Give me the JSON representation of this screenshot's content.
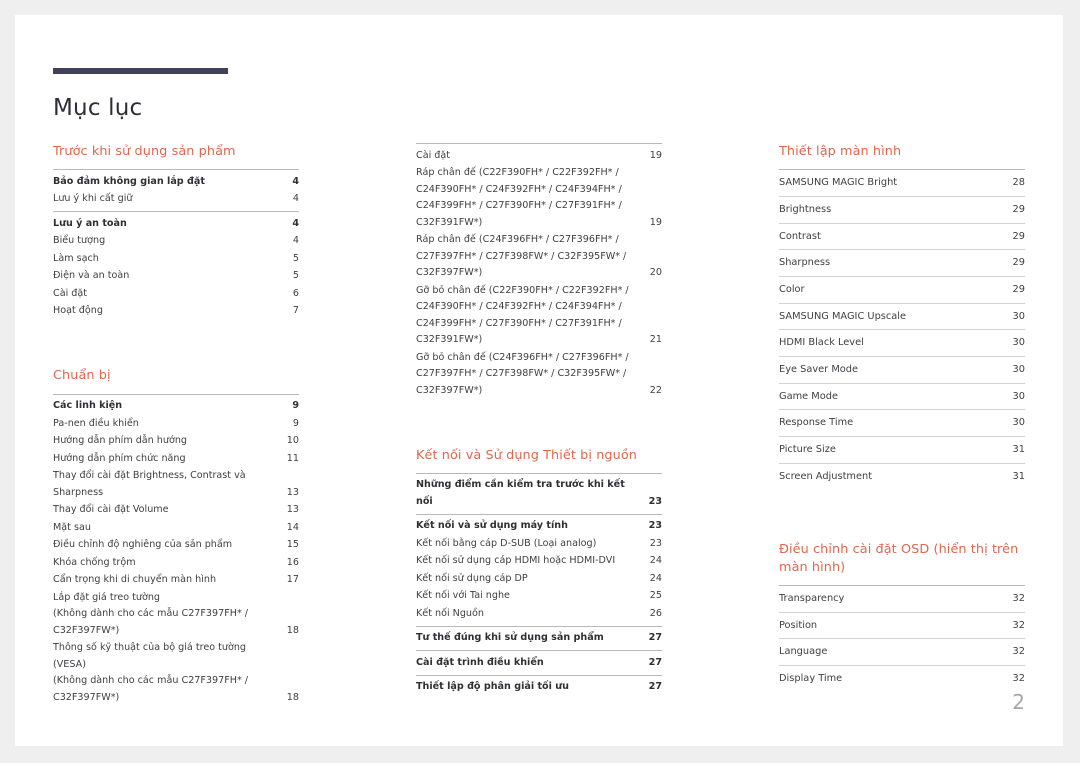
{
  "document": {
    "title": "Mục lục",
    "page_number": "2",
    "accent_color": "#e0674a",
    "rule_color": "#41415a"
  },
  "columns": [
    {
      "id": "column-left",
      "sections": [
        {
          "heading": "Trước khi sử dụng sản phẩm",
          "groups": [
            {
              "rows": [
                {
                  "label": "Bảo đảm không gian lắp đặt",
                  "page": "4",
                  "bold": true
                },
                {
                  "label": "Lưu ý khi cất giữ",
                  "page": "4",
                  "bold": false
                }
              ]
            },
            {
              "rows": [
                {
                  "label": "Lưu ý an toàn",
                  "page": "4",
                  "bold": true
                },
                {
                  "label": "Biểu tượng",
                  "page": "4",
                  "bold": false
                },
                {
                  "label": "Làm sạch",
                  "page": "5",
                  "bold": false
                },
                {
                  "label": "Điện và an toàn",
                  "page": "5",
                  "bold": false
                },
                {
                  "label": "Cài đặt",
                  "page": "6",
                  "bold": false
                },
                {
                  "label": "Hoạt động",
                  "page": "7",
                  "bold": false
                }
              ]
            }
          ]
        },
        {
          "heading": "Chuẩn bị",
          "groups": [
            {
              "rows": [
                {
                  "label": "Các linh kiện",
                  "page": "9",
                  "bold": true
                },
                {
                  "label": "Pa-nen điều khiển",
                  "page": "9",
                  "bold": false
                },
                {
                  "label": "Hướng dẫn phím dẫn hướng",
                  "page": "10",
                  "bold": false
                },
                {
                  "label": "Hướng dẫn phím chức năng",
                  "page": "11",
                  "bold": false
                },
                {
                  "label": "Thay đổi cài đặt Brightness, Contrast và\nSharpness",
                  "page": "13",
                  "bold": false
                },
                {
                  "label": "Thay đổi cài đặt Volume",
                  "page": "13",
                  "bold": false
                },
                {
                  "label": "Mặt sau",
                  "page": "14",
                  "bold": false
                },
                {
                  "label": "Điều chỉnh độ nghiêng của sản phẩm",
                  "page": "15",
                  "bold": false
                },
                {
                  "label": "Khóa chống trộm",
                  "page": "16",
                  "bold": false
                },
                {
                  "label": "Cẩn trọng khi di chuyển màn hình",
                  "page": "17",
                  "bold": false
                },
                {
                  "label": "Lắp đặt giá treo tường\n(Không dành cho các mẫu C27F397FH* /\nC32F397FW*)",
                  "page": "18",
                  "bold": false
                },
                {
                  "label": "Thông số kỹ thuật của bộ giá treo tường (VESA)\n(Không dành cho các mẫu C27F397FH* /\nC32F397FW*)",
                  "page": "18",
                  "bold": false
                }
              ]
            }
          ]
        }
      ]
    },
    {
      "id": "column-middle",
      "sections": [
        {
          "heading": "",
          "groups": [
            {
              "rows": [
                {
                  "label": "Cài đặt",
                  "page": "19",
                  "bold": false
                },
                {
                  "label": "Ráp chân đế (C22F390FH* / C22F392FH* /\nC24F390FH* / C24F392FH* / C24F394FH* /\nC24F399FH* / C27F390FH* / C27F391FH* /\nC32F391FW*)",
                  "page": "19",
                  "bold": false
                },
                {
                  "label": "Ráp chân đế (C24F396FH* / C27F396FH* /\nC27F397FH* / C27F398FW* / C32F395FW* /\nC32F397FW*)",
                  "page": "20",
                  "bold": false
                },
                {
                  "label": "Gỡ bỏ chân đế (C22F390FH* / C22F392FH* /\nC24F390FH* / C24F392FH* / C24F394FH* /\nC24F399FH* / C27F390FH* / C27F391FH* /\nC32F391FW*)",
                  "page": "21",
                  "bold": false
                },
                {
                  "label": "Gỡ bỏ chân đế (C24F396FH* / C27F396FH* /\nC27F397FH* / C27F398FW* / C32F395FW* /\nC32F397FW*)",
                  "page": "22",
                  "bold": false
                }
              ]
            }
          ]
        },
        {
          "heading": "Kết nối và Sử dụng Thiết bị nguồn",
          "groups": [
            {
              "rows": [
                {
                  "label": "Những điểm cần kiểm tra trước khi kết nối",
                  "page": "23",
                  "bold": true
                }
              ]
            },
            {
              "rows": [
                {
                  "label": "Kết nối và sử dụng máy tính",
                  "page": "23",
                  "bold": true
                },
                {
                  "label": "Kết nối bằng cáp D-SUB (Loại analog)",
                  "page": "23",
                  "bold": false
                },
                {
                  "label": "Kết nối sử dụng cáp HDMI hoặc HDMI-DVI",
                  "page": "24",
                  "bold": false
                },
                {
                  "label": "Kết nối sử dụng cáp DP",
                  "page": "24",
                  "bold": false
                },
                {
                  "label": "Kết nối với Tai nghe",
                  "page": "25",
                  "bold": false
                },
                {
                  "label": "Kết nối Nguồn",
                  "page": "26",
                  "bold": false
                }
              ]
            },
            {
              "rows": [
                {
                  "label": "Tư thế đúng khi sử dụng sản phẩm",
                  "page": "27",
                  "bold": true
                }
              ]
            },
            {
              "rows": [
                {
                  "label": "Cài đặt trình điều khiển",
                  "page": "27",
                  "bold": true
                }
              ]
            },
            {
              "rows": [
                {
                  "label": "Thiết lập độ phân giải tối ưu",
                  "page": "27",
                  "bold": true
                }
              ]
            }
          ]
        }
      ]
    },
    {
      "id": "column-right",
      "sections": [
        {
          "heading": "Thiết lập màn hình",
          "ruled_rows": true,
          "groups": [
            {
              "rows": [
                {
                  "label": "SAMSUNG MAGIC Bright",
                  "page": "28",
                  "bold": false
                },
                {
                  "label": "Brightness",
                  "page": "29",
                  "bold": false
                },
                {
                  "label": "Contrast",
                  "page": "29",
                  "bold": false
                },
                {
                  "label": "Sharpness",
                  "page": "29",
                  "bold": false
                },
                {
                  "label": "Color",
                  "page": "29",
                  "bold": false
                },
                {
                  "label": "SAMSUNG MAGIC Upscale",
                  "page": "30",
                  "bold": false
                },
                {
                  "label": "HDMI Black Level",
                  "page": "30",
                  "bold": false
                },
                {
                  "label": "Eye Saver Mode",
                  "page": "30",
                  "bold": false
                },
                {
                  "label": "Game Mode",
                  "page": "30",
                  "bold": false
                },
                {
                  "label": "Response Time",
                  "page": "30",
                  "bold": false
                },
                {
                  "label": "Picture Size",
                  "page": "31",
                  "bold": false
                },
                {
                  "label": "Screen Adjustment",
                  "page": "31",
                  "bold": false
                }
              ]
            }
          ]
        },
        {
          "heading": "Điều chỉnh cài đặt OSD (hiển\nthị trên màn hình)",
          "ruled_rows": true,
          "groups": [
            {
              "rows": [
                {
                  "label": "Transparency",
                  "page": "32",
                  "bold": false
                },
                {
                  "label": "Position",
                  "page": "32",
                  "bold": false
                },
                {
                  "label": "Language",
                  "page": "32",
                  "bold": false
                },
                {
                  "label": "Display Time",
                  "page": "32",
                  "bold": false
                }
              ]
            }
          ]
        }
      ]
    }
  ]
}
